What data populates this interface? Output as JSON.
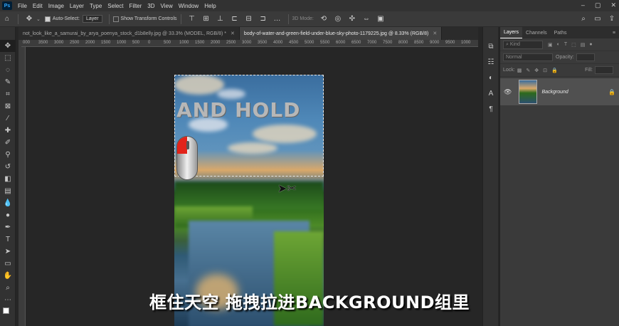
{
  "app": {
    "logo": "Ps"
  },
  "menu": [
    "File",
    "Edit",
    "Image",
    "Layer",
    "Type",
    "Select",
    "Filter",
    "3D",
    "View",
    "Window",
    "Help"
  ],
  "window_controls": [
    "–",
    "▢",
    "✕"
  ],
  "options_bar": {
    "auto_select_label": "Auto-Select:",
    "auto_select_checked": true,
    "target_value": "Layer",
    "show_transform_label": "Show Transform Controls",
    "mode_3d_label": "3D Mode:"
  },
  "tabs": [
    {
      "label": "not_look_like_a_samurai_by_arya_poenya_stock_d1b8elly.jpg @ 33.3% (MODEL, RGB/8) *",
      "active": false
    },
    {
      "label": "body-of-water-and-green-field-under-blue-sky-photo-1179225.jpg @ 8.33% (RGB/8)",
      "active": true
    }
  ],
  "ruler_ticks": [
    "000",
    "3500",
    "3000",
    "2500",
    "2000",
    "1500",
    "1000",
    "500",
    "0",
    "500",
    "1000",
    "1500",
    "2000",
    "2500",
    "3000",
    "3500",
    "4000",
    "4500",
    "5000",
    "5500",
    "6000",
    "6500",
    "7000",
    "7500",
    "8000",
    "8500",
    "9000",
    "9500",
    "1000"
  ],
  "canvas": {
    "overlay_text": "AND HOLD"
  },
  "subtitle": "框住天空 拖拽拉进BACKGROUND组里",
  "layers_panel": {
    "tabs": [
      "Layers",
      "Channels",
      "Paths"
    ],
    "kind_placeholder": "Kind",
    "blend_mode": "Normal",
    "opacity_label": "Opacity:",
    "lock_label": "Lock:",
    "fill_label": "Fill:",
    "layers": [
      {
        "name": "Background",
        "visible": true,
        "locked": true
      }
    ]
  },
  "colors": {
    "accent": "#31a8ff",
    "mouse_button": "#e2231a"
  }
}
